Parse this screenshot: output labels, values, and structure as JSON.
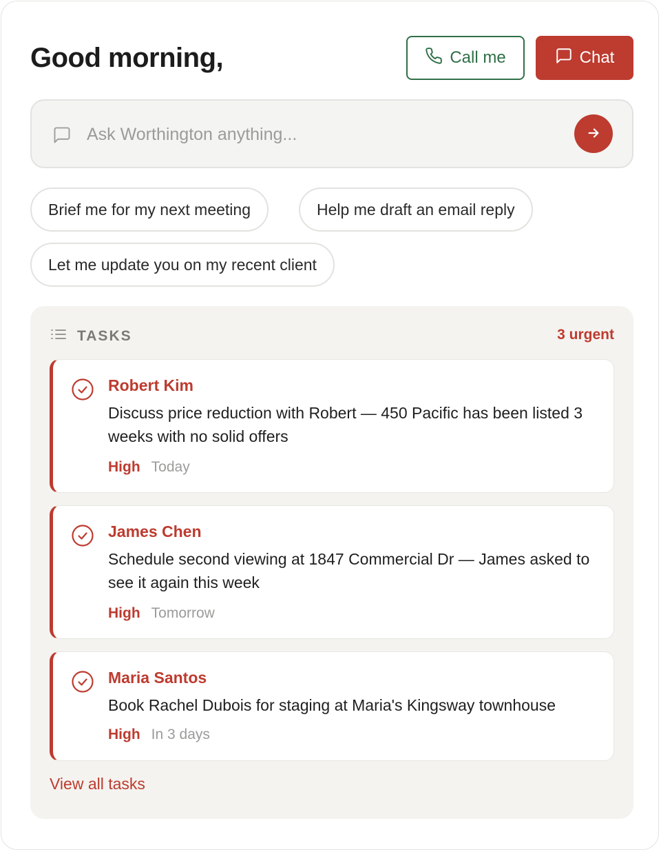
{
  "greeting": "Good morning,",
  "actions": {
    "call_label": "Call me",
    "chat_label": "Chat"
  },
  "ask": {
    "placeholder": "Ask Worthington anything...",
    "value": ""
  },
  "suggestions": [
    "Brief me for my next meeting",
    "Help me draft an email reply",
    "Let me update you on my recent client"
  ],
  "tasks": {
    "title": "TASKS",
    "urgent_label": "3 urgent",
    "view_all_label": "View all tasks",
    "items": [
      {
        "client": "Robert Kim",
        "description": "Discuss price reduction with Robert — 450 Pacific has been listed 3 weeks with no solid offers",
        "priority": "High",
        "due": "Today"
      },
      {
        "client": "James Chen",
        "description": "Schedule second viewing at 1847 Commercial Dr — James asked to see it again this week",
        "priority": "High",
        "due": "Tomorrow"
      },
      {
        "client": "Maria Santos",
        "description": "Book Rachel Dubois for staging at Maria's Kingsway townhouse",
        "priority": "High",
        "due": "In 3 days"
      }
    ]
  },
  "colors": {
    "accent": "#bd3b2f",
    "call_green": "#2f6f47",
    "panel_bg": "#f4f3ef",
    "muted_text": "#9b9b98"
  },
  "icons": {
    "call": "phone-icon",
    "chat": "chat-bubble-icon",
    "ask": "message-square-icon",
    "send": "arrow-right-icon",
    "tasks": "list-icon",
    "task": "check-circle-icon"
  }
}
